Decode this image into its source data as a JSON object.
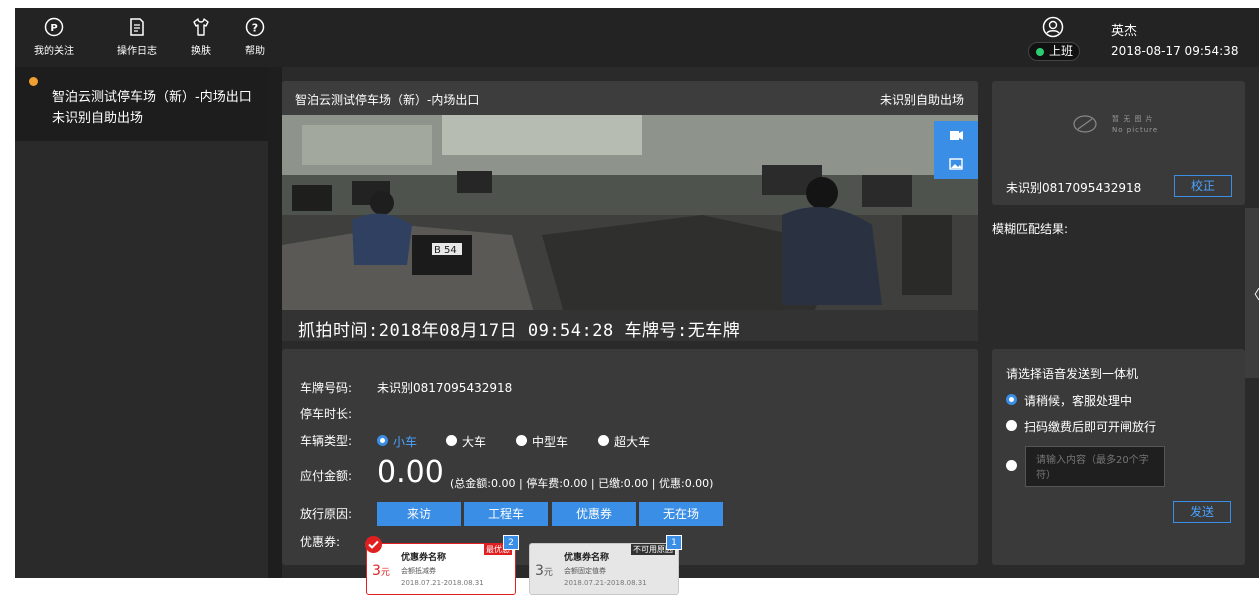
{
  "toolbar": {
    "items": [
      {
        "label": "我的关注",
        "icon": "parking-icon"
      },
      {
        "label": "操作日志",
        "icon": "document-icon"
      },
      {
        "label": "换肤",
        "icon": "shirt-icon"
      },
      {
        "label": "帮助",
        "icon": "help-icon"
      }
    ]
  },
  "user": {
    "name": "英杰",
    "shift_status": "上班",
    "datetime": "2018-08-17 09:54:38"
  },
  "sidebar": {
    "items": [
      {
        "title": "智泊云测试停车场（新）-内场出口",
        "subtitle": "未识别自助出场"
      }
    ]
  },
  "camera": {
    "location": "智泊云测试停车场（新）-内场出口",
    "status": "未识别自助出场",
    "caption": "抓拍时间:2018年08月17日 09:54:28 车牌号:无车牌",
    "visible_plate_text": "B 54"
  },
  "plate_panel": {
    "no_picture_cn": "暂 无 图 片",
    "no_picture_en": "No picture",
    "plate": "未识别0817095432918",
    "correct_label": "校正",
    "fuzzy_label": "模糊匹配结果:"
  },
  "info": {
    "plate_label": "车牌号码:",
    "plate_value": "未识别0817095432918",
    "duration_label": "停车时长:",
    "duration_value": "",
    "type_label": "车辆类型:",
    "vehicle_types": [
      "小车",
      "大车",
      "中型车",
      "超大车"
    ],
    "selected_type": "小车",
    "amount_label": "应付金额:",
    "amount": "0.00",
    "amount_detail": "(总金额:0.00 | 停车费:0.00 | 已缴:0.00 | 优惠:0.00)",
    "release_label": "放行原因:",
    "release_reasons": [
      "来访",
      "工程车",
      "优惠券",
      "无在场"
    ],
    "coupon_label": "优惠券:"
  },
  "coupons": [
    {
      "name": "优惠券名称",
      "amount": "3",
      "unit": "元",
      "type": "会额抵减券",
      "period": "2018.07.21-2018.08.31",
      "tag": "最优惠",
      "count": "2",
      "selected": true
    },
    {
      "name": "优惠券名称",
      "amount": "3",
      "unit": "元",
      "type": "会额固定值券",
      "period": "2018.07.21-2018.08.31",
      "tag": "不可用原因",
      "count": "1",
      "selected": false
    }
  ],
  "voice": {
    "title": "请选择语音发送到一体机",
    "options": [
      "请稍候，客服处理中",
      "扫码缴费后即可开闸放行"
    ],
    "selected_index": 0,
    "input_placeholder": "请输入内容（最多20个字符）",
    "send_label": "发送"
  },
  "colors": {
    "accent": "#3a8ee6",
    "panel": "#3a3a3a",
    "background": "#2a2a2a",
    "topbar": "#232323",
    "coupon_red": "#e02020",
    "online_dot": "#2ecc71",
    "item_dot": "#f0a030"
  }
}
